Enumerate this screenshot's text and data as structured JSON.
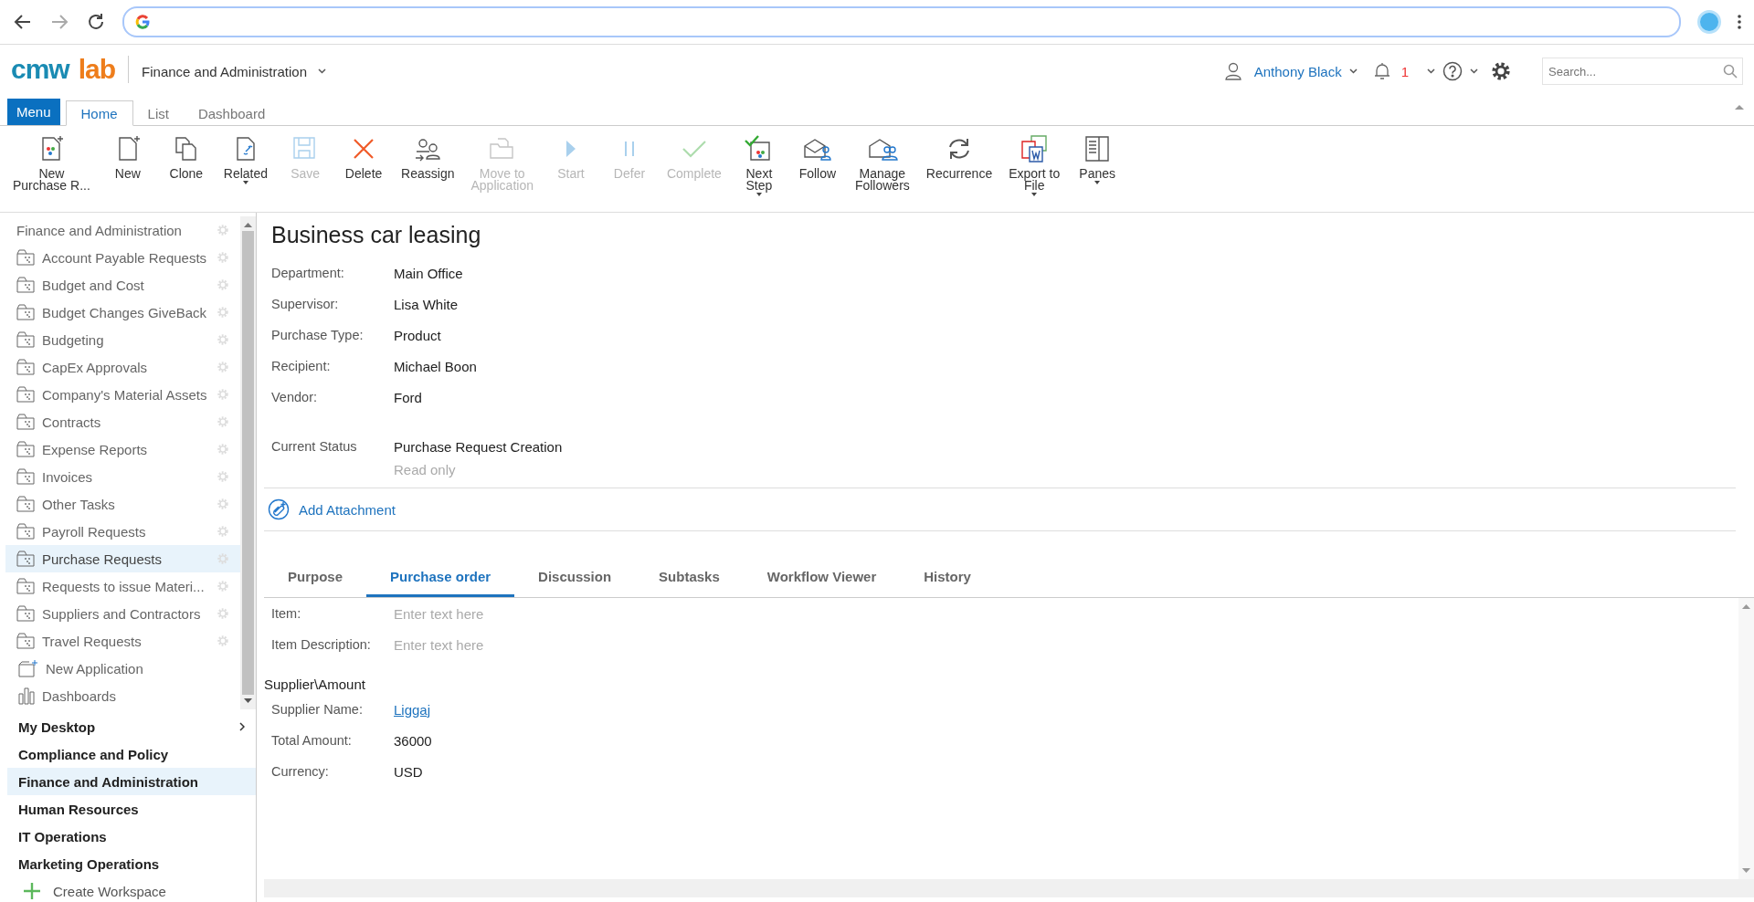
{
  "app": {
    "logo_left": "cmw",
    "logo_right": "lab",
    "workspace": "Finance and Administration",
    "user": "Anthony Black",
    "notifications": "1",
    "search": {
      "placeholder": "Search..."
    }
  },
  "menu_button": "Menu",
  "ribbon_tabs": [
    {
      "label": "Home",
      "selected": true
    },
    {
      "label": "List",
      "selected": false
    },
    {
      "label": "Dashboard",
      "selected": false
    }
  ],
  "toolbar": [
    {
      "label": "New\nPurchase R...",
      "disabled": false,
      "dropdown": false
    },
    {
      "label": "New",
      "disabled": false,
      "dropdown": false
    },
    {
      "label": "Clone",
      "disabled": false,
      "dropdown": false
    },
    {
      "label": "Related",
      "disabled": false,
      "dropdown": true
    },
    {
      "label": "Save",
      "disabled": true,
      "dropdown": false
    },
    {
      "label": "Delete",
      "disabled": false,
      "dropdown": false
    },
    {
      "label": "Reassign",
      "disabled": false,
      "dropdown": false
    },
    {
      "label": "Move to\nApplication",
      "disabled": true,
      "dropdown": false
    },
    {
      "label": "Start",
      "disabled": true,
      "dropdown": false
    },
    {
      "label": "Defer",
      "disabled": true,
      "dropdown": false
    },
    {
      "label": "Complete",
      "disabled": true,
      "dropdown": false
    },
    {
      "label": "Next\nStep",
      "disabled": false,
      "dropdown": true
    },
    {
      "label": "Follow",
      "disabled": false,
      "dropdown": false
    },
    {
      "label": "Manage\nFollowers",
      "disabled": false,
      "dropdown": false
    },
    {
      "label": "Recurrence",
      "disabled": false,
      "dropdown": false
    },
    {
      "label": "Export to\nFile",
      "disabled": false,
      "dropdown": true
    },
    {
      "label": "Panes",
      "disabled": false,
      "dropdown": true
    }
  ],
  "sidebar": {
    "tree": {
      "label": "Finance and Administration",
      "children": [
        {
          "label": "Account Payable Requests",
          "kind": "app",
          "selected": false
        },
        {
          "label": "Budget and Cost",
          "kind": "app",
          "selected": false
        },
        {
          "label": "Budget Changes GiveBack",
          "kind": "app",
          "selected": false
        },
        {
          "label": "Budgeting",
          "kind": "app",
          "selected": false
        },
        {
          "label": "CapEx Approvals",
          "kind": "app",
          "selected": false
        },
        {
          "label": "Company's Material Assets",
          "kind": "app",
          "selected": false
        },
        {
          "label": "Contracts",
          "kind": "app",
          "selected": false
        },
        {
          "label": "Expense Reports",
          "kind": "app",
          "selected": false
        },
        {
          "label": "Invoices",
          "kind": "app",
          "selected": false
        },
        {
          "label": "Other Tasks",
          "kind": "app",
          "selected": false
        },
        {
          "label": "Payroll Requests",
          "kind": "app",
          "selected": false
        },
        {
          "label": "Purchase Requests",
          "kind": "app",
          "selected": true
        },
        {
          "label": "Requests to issue Materi...",
          "kind": "app",
          "selected": false
        },
        {
          "label": "Suppliers and Contractors",
          "kind": "app",
          "selected": false
        },
        {
          "label": "Travel Requests",
          "kind": "app",
          "selected": false
        },
        {
          "label": "New Application",
          "kind": "new",
          "selected": false
        },
        {
          "label": "Dashboards",
          "kind": "dashboards",
          "selected": false
        }
      ]
    },
    "workspaces": [
      {
        "label": "My Desktop",
        "selected": false,
        "expandable": true
      },
      {
        "label": "Compliance and Policy",
        "selected": false,
        "expandable": false
      },
      {
        "label": "Finance and Administration",
        "selected": true,
        "expandable": false
      },
      {
        "label": "Human Resources",
        "selected": false,
        "expandable": false
      },
      {
        "label": "IT Operations",
        "selected": false,
        "expandable": false
      },
      {
        "label": "Marketing Operations",
        "selected": false,
        "expandable": false
      }
    ],
    "create": "Create Workspace"
  },
  "record": {
    "title": "Business car leasing",
    "fields": [
      {
        "label": "Department:",
        "value": "Main Office"
      },
      {
        "label": "Supervisor:",
        "value": "Lisa White"
      },
      {
        "label": "Purchase Type:",
        "value": "Product"
      },
      {
        "label": "Recipient:",
        "value": "Michael Boon"
      },
      {
        "label": "Vendor:",
        "value": "Ford"
      }
    ],
    "status": {
      "label": "Current Status",
      "value": "Purchase Request Creation",
      "note": "Read only"
    },
    "attachment": "Add Attachment",
    "tabs": [
      {
        "label": "Purpose",
        "selected": false
      },
      {
        "label": "Purchase order",
        "selected": true
      },
      {
        "label": "Discussion",
        "selected": false
      },
      {
        "label": "Subtasks",
        "selected": false
      },
      {
        "label": "Workflow Viewer",
        "selected": false
      },
      {
        "label": "History",
        "selected": false
      }
    ],
    "order_fields": [
      {
        "label": "Item:",
        "placeholder": "Enter text here"
      },
      {
        "label": "Item Description:",
        "placeholder": "Enter text here"
      }
    ],
    "section": "Supplier\\Amount",
    "supplier_fields": [
      {
        "label": "Supplier Name:",
        "value": "Liggaj",
        "kind": "link"
      },
      {
        "label": "Total Amount:",
        "value": "36000",
        "kind": "text"
      },
      {
        "label": "Currency:",
        "value": "USD",
        "kind": "text"
      }
    ]
  }
}
